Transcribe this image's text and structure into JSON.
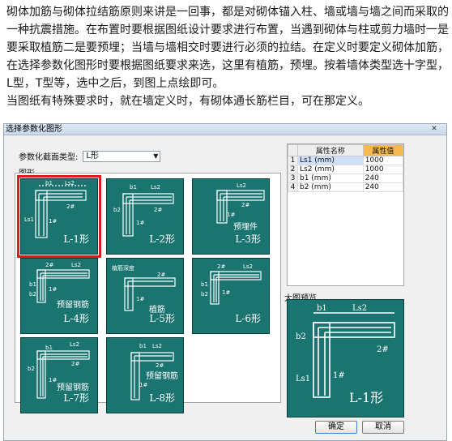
{
  "article": {
    "paragraphs": [
      "砌体加筋与砌体拉结筋原则来讲是一回事，都是对砌体锚入柱、墙或墙与墙之间而采取的一种抗震措施。在布置时要根据图纸设计要求进行布置，当遇到砌体与柱或剪力墙时一是要采取植筋二是要预埋；当墙与墙相交时要进行必须的拉结。在定义时要定义砌体加筋，在选择参数化图形时要根据图纸要求来选，这里有植筋，预埋。按着墙体类型选十字型，L型，T型等，选中之后，到图上点绘即可。",
      "当图纸有特殊要求时，就在墙定义时，有砌体通长筋栏目，可在那定义。"
    ]
  },
  "dialog": {
    "title": "选择参数化图形",
    "close_glyph": "✕",
    "section_type_label": "参数化截面类型:",
    "section_type_value": "L形",
    "shapes_group_label": "图形",
    "preview_label": "大图预览",
    "ok_label": "确定",
    "cancel_label": "取消"
  },
  "shapes": [
    {
      "name": "L-1形",
      "selected": true,
      "note": "",
      "labels": [
        "b1",
        "Ls2",
        "Ls1",
        "2#",
        "1#"
      ]
    },
    {
      "name": "L-2形",
      "selected": false,
      "note": "",
      "labels": [
        "b1",
        "Ls2",
        "b2",
        "2#",
        "1#"
      ]
    },
    {
      "name": "L-3形",
      "selected": false,
      "note": "预埋件",
      "labels": [
        "Ls2",
        "2#",
        "1#"
      ]
    },
    {
      "name": "L-4形",
      "selected": false,
      "note": "预留钢筋",
      "labels": [
        "2#",
        "Ls2",
        "b1",
        "b2",
        "1#"
      ]
    },
    {
      "name": "L-5形",
      "selected": false,
      "note": "植筋",
      "labels": [
        "植筋深度",
        "2#",
        "1#"
      ]
    },
    {
      "name": "L-6形",
      "selected": false,
      "note": "",
      "labels": [
        "2#",
        "Ls2",
        "b1",
        "b2",
        "1#"
      ]
    },
    {
      "name": "L-7形",
      "selected": false,
      "note": "预留钢筋",
      "labels": [
        "Ls2",
        "b1",
        "b2",
        "2#",
        "1#"
      ]
    },
    {
      "name": "L-8形",
      "selected": false,
      "note": "预留钢筋",
      "labels": [
        "Ls2",
        "b1",
        "2#",
        "1#"
      ]
    }
  ],
  "properties": {
    "headers": [
      "属性名称",
      "属性值"
    ],
    "rows": [
      {
        "index": "1",
        "name": "Ls1 (mm)",
        "value": "1000"
      },
      {
        "index": "2",
        "name": "Ls2 (mm)",
        "value": "1000"
      },
      {
        "index": "3",
        "name": "b1 (mm)",
        "value": "240"
      },
      {
        "index": "4",
        "name": "b2 (mm)",
        "value": "240"
      }
    ]
  },
  "preview": {
    "name": "L-1形",
    "labels": [
      "b1",
      "Ls2",
      "b2",
      "2#",
      "1#",
      "Ls1"
    ]
  },
  "colors": {
    "tile_bg": "#1a7470",
    "selected_outline": "#e01a1a",
    "value_header": "#f6b94d"
  }
}
